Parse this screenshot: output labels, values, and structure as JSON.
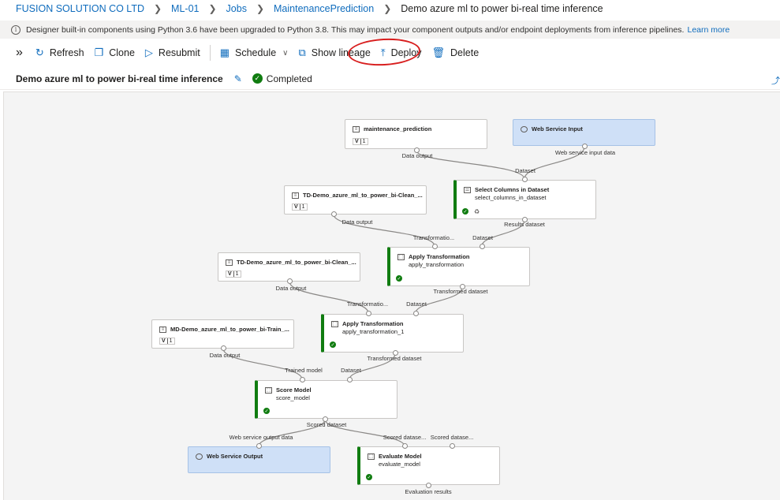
{
  "breadcrumb": {
    "items": [
      "FUSION SOLUTION CO LTD",
      "ML-01",
      "Jobs",
      "MaintenancePrediction"
    ],
    "current": "Demo azure ml to power bi-real time inference"
  },
  "notice": {
    "text": "Designer built-in components using Python 3.6 have been upgraded to Python 3.8. This may impact your component outputs and/or endpoint deployments from inference pipelines.",
    "link": "Learn more"
  },
  "toolbar": {
    "expand_glyph": "»",
    "refresh": "Refresh",
    "clone": "Clone",
    "resubmit": "Resubmit",
    "schedule": "Schedule",
    "show_lineage": "Show lineage",
    "deploy": "Deploy",
    "delete": "Delete"
  },
  "job": {
    "title": "Demo azure ml to power bi-real time inference",
    "status": "Completed",
    "status_color": "#107c10"
  },
  "nodes": {
    "maintenance_prediction": {
      "title": "maintenance_prediction",
      "version": "1"
    },
    "web_service_input": {
      "title": "Web Service Input"
    },
    "select_columns": {
      "title": "Select Columns in Dataset",
      "subtitle": "select_columns_in_dataset"
    },
    "td_clean_1": {
      "title": "TD-Demo_azure_ml_to_power_bi-Clean_...",
      "version": "1"
    },
    "apply_transform": {
      "title": "Apply Transformation",
      "subtitle": "apply_transformation"
    },
    "td_clean_2": {
      "title": "TD-Demo_azure_ml_to_power_bi-Clean_...",
      "version": "1"
    },
    "apply_transform_1": {
      "title": "Apply Transformation",
      "subtitle": "apply_transformation_1"
    },
    "md_train": {
      "title": "MD-Demo_azure_ml_to_power_bi-Train_...",
      "version": "1"
    },
    "score_model": {
      "title": "Score Model",
      "subtitle": "score_model"
    },
    "web_service_output": {
      "title": "Web Service Output"
    },
    "evaluate_model": {
      "title": "Evaluate Model",
      "subtitle": "evaluate_model"
    }
  },
  "ports": {
    "data_output": "Data output",
    "web_service_input_data": "Web service input data",
    "dataset": "Dataset",
    "results_dataset": "Results dataset",
    "transformation_trunc": "Transformatio...",
    "transformation_trunc_2": "Transformatio...",
    "transformed_dataset": "Transformed dataset",
    "trained_model": "Trained model",
    "scored_dataset": "Scored dataset",
    "web_service_output_data": "Web service output data",
    "scored_dataset_trunc": "Scored datase...",
    "evaluation_results": "Evaluation results"
  },
  "colors": {
    "accent": "#0f6cbd",
    "success": "#107c10",
    "web_service_node": "#cfe0f7",
    "annotation_ring": "#d81e1e"
  }
}
